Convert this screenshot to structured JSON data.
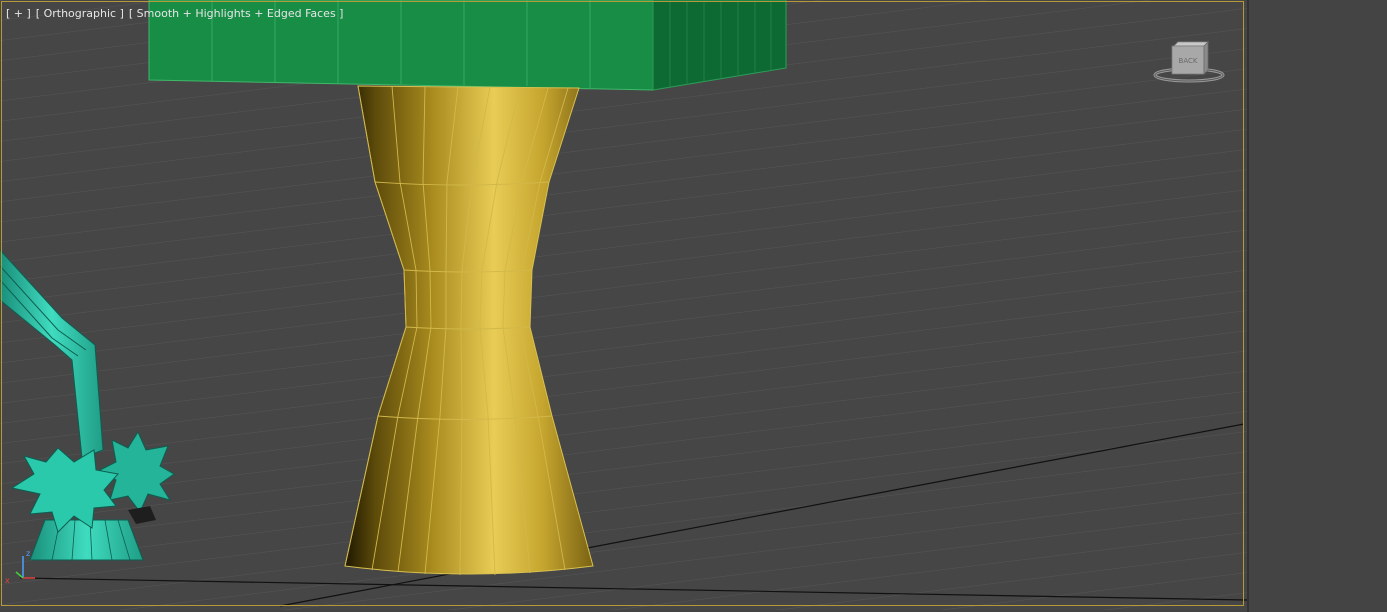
{
  "viewport": {
    "label_plus": "[ + ]",
    "label_view": "[ Orthographic ]",
    "label_shading": "[ Smooth + Highlights + Edged Faces ]"
  },
  "viewcube": {
    "face_label": "BACK"
  },
  "colors": {
    "viewport_border": "#b69a3a",
    "viewport_bg": "#464646",
    "green_object": "#178a46",
    "gold_object": "#c9a72c",
    "teal_object": "#26bfa3",
    "panel_bg": "#444444"
  }
}
